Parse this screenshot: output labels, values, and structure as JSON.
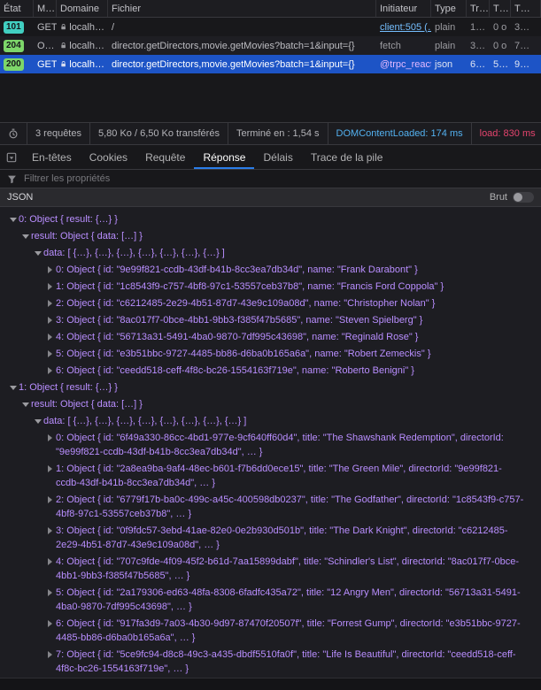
{
  "network": {
    "columns": [
      "État",
      "M…",
      "Domaine",
      "Fichier",
      "Initiateur",
      "Type",
      "Tr…",
      "T…",
      "T…"
    ],
    "rows": [
      {
        "status": "101",
        "method": "GET",
        "domain": "localh…",
        "file": "/",
        "initiator": "client:505 (…",
        "type": "plain",
        "transferred": "1…",
        "size": "0 o",
        "time": "3…"
      },
      {
        "status": "204",
        "method": "O…",
        "domain": "localh…",
        "file": "director.getDirectors,movie.getMovies?batch=1&input={}",
        "initiator": "fetch",
        "type": "plain",
        "transferred": "3…",
        "size": "0 o",
        "time": "7…"
      },
      {
        "status": "200",
        "method": "GET",
        "domain": "localh…",
        "file": "director.getDirectors,movie.getMovies?batch=1&input={}",
        "initiator": "@trpc_react…",
        "type": "json",
        "transferred": "6…",
        "size": "5…",
        "time": "9…"
      }
    ]
  },
  "summary": {
    "requests": "3 requêtes",
    "transferred": "5,80 Ko / 6,50 Ko transférés",
    "finish": "Terminé en : 1,54 s",
    "dom_content_loaded": "DOMContentLoaded: 174 ms",
    "load": "load: 830 ms"
  },
  "detail_tabs": {
    "items": [
      "En-têtes",
      "Cookies",
      "Requête",
      "Réponse",
      "Délais",
      "Trace de la pile"
    ],
    "active": "Réponse"
  },
  "filter": {
    "placeholder": "Filtrer les propriétés"
  },
  "response_panel": {
    "section_label": "JSON",
    "raw_label": "Brut",
    "raw_enabled": false
  },
  "tree": {
    "rows": [
      {
        "depth": 1,
        "expanded": true,
        "text": "0: Object { result: {…} }"
      },
      {
        "depth": 2,
        "expanded": true,
        "text": "result: Object { data: […] }"
      },
      {
        "depth": 3,
        "expanded": true,
        "text": "data: [ {…}, {…}, {…}, {…}, {…}, {…}, {…} ]"
      },
      {
        "depth": 4,
        "expanded": false,
        "text": "0: Object { id: \"9e99f821-ccdb-43df-b41b-8cc3ea7db34d\", name: \"Frank Darabont\" }"
      },
      {
        "depth": 4,
        "expanded": false,
        "text": "1: Object { id: \"1c8543f9-c757-4bf8-97c1-53557ceb37b8\", name: \"Francis Ford Coppola\" }"
      },
      {
        "depth": 4,
        "expanded": false,
        "text": "2: Object { id: \"c6212485-2e29-4b51-87d7-43e9c109a08d\", name: \"Christopher Nolan\" }"
      },
      {
        "depth": 4,
        "expanded": false,
        "text": "3: Object { id: \"8ac017f7-0bce-4bb1-9bb3-f385f47b5685\", name: \"Steven Spielberg\" }"
      },
      {
        "depth": 4,
        "expanded": false,
        "text": "4: Object { id: \"56713a31-5491-4ba0-9870-7df995c43698\", name: \"Reginald Rose\" }"
      },
      {
        "depth": 4,
        "expanded": false,
        "text": "5: Object { id: \"e3b51bbc-9727-4485-bb86-d6ba0b165a6a\", name: \"Robert Zemeckis\" }"
      },
      {
        "depth": 4,
        "expanded": false,
        "text": "6: Object { id: \"ceedd518-ceff-4f8c-bc26-1554163f719e\", name: \"Roberto Benigni\" }"
      },
      {
        "depth": 1,
        "expanded": true,
        "text": "1: Object { result: {…} }"
      },
      {
        "depth": 2,
        "expanded": true,
        "text": "result: Object { data: […] }"
      },
      {
        "depth": 3,
        "expanded": true,
        "text": "data: [ {…}, {…}, {…}, {…}, {…}, {…}, {…}, {…} ]"
      },
      {
        "depth": 4,
        "expanded": false,
        "text": "0: Object { id: \"6f49a330-86cc-4bd1-977e-9cf640ff60d4\", title: \"The Shawshank Redemption\", directorId: \"9e99f821-ccdb-43df-b41b-8cc3ea7db34d\", … }"
      },
      {
        "depth": 4,
        "expanded": false,
        "text": "1: Object { id: \"2a8ea9ba-9af4-48ec-b601-f7b6dd0ece15\", title: \"The Green Mile\", directorId: \"9e99f821-ccdb-43df-b41b-8cc3ea7db34d\", … }"
      },
      {
        "depth": 4,
        "expanded": false,
        "text": "2: Object { id: \"6779f17b-ba0c-499c-a45c-400598db0237\", title: \"The Godfather\", directorId: \"1c8543f9-c757-4bf8-97c1-53557ceb37b8\", … }"
      },
      {
        "depth": 4,
        "expanded": false,
        "text": "3: Object { id: \"0f9fdc57-3ebd-41ae-82e0-0e2b930d501b\", title: \"The Dark Knight\", directorId: \"c6212485-2e29-4b51-87d7-43e9c109a08d\", … }"
      },
      {
        "depth": 4,
        "expanded": false,
        "text": "4: Object { id: \"707c9fde-4f09-45f2-b61d-7aa15899dabf\", title: \"Schindler's List\", directorId: \"8ac017f7-0bce-4bb1-9bb3-f385f47b5685\", … }"
      },
      {
        "depth": 4,
        "expanded": false,
        "text": "5: Object { id: \"2a179306-ed63-48fa-8308-6fadfc435a72\", title: \"12 Angry Men\", directorId: \"56713a31-5491-4ba0-9870-7df995c43698\", … }"
      },
      {
        "depth": 4,
        "expanded": false,
        "text": "6: Object { id: \"917fa3d9-7a03-4b30-9d97-87470f20507f\", title: \"Forrest Gump\", directorId: \"e3b51bbc-9727-4485-bb86-d6ba0b165a6a\", … }"
      },
      {
        "depth": 4,
        "expanded": false,
        "text": "7: Object { id: \"5ce9fc94-d8c8-49c3-a435-dbdf5510fa0f\", title: \"Life Is Beautiful\", directorId: \"ceedd518-ceff-4f8c-bc26-1554163f719e\", … }"
      }
    ]
  },
  "icons": {
    "domain_security": "lock-icon",
    "summary_left": "stopwatch-icon",
    "filter": "funnel-icon",
    "details_panel": "panel-toggle-icon",
    "tree_expanded": "triangle-down-icon",
    "tree_collapsed": "triangle-right-icon"
  },
  "colors": {
    "selection_blue": "#1d54c6",
    "status_green": "#7dd66a",
    "status_teal": "#41cfc1",
    "tree_purple": "#b98eff",
    "link_blue": "#75bfff",
    "dom_content_loaded_blue": "#53b1f0",
    "load_red": "#e5446e",
    "active_tab_underline": "#2b7de9"
  }
}
